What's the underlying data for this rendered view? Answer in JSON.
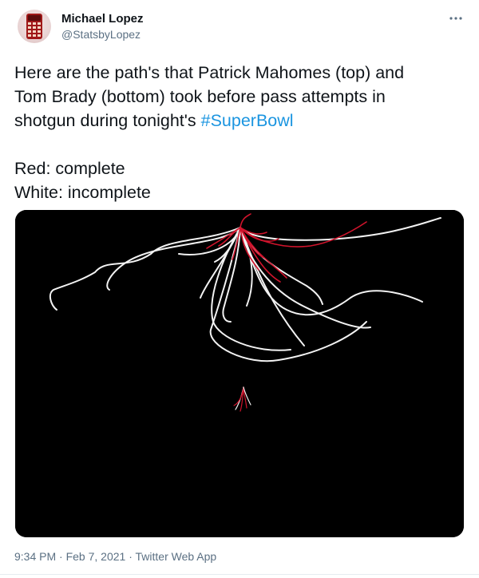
{
  "author": {
    "name": "Michael Lopez",
    "handle": "@StatsbyLopez"
  },
  "tweet": {
    "line1": "Here are the path's that Patrick Mahomes (top) and",
    "line2": "Tom Brady (bottom) took before pass attempts in",
    "line3_prefix": "shotgun during tonight's ",
    "hashtag": "#SuperBowl",
    "legend_red": "Red: complete",
    "legend_white": "White: incomplete"
  },
  "footer": {
    "time": "9:34 PM",
    "separator": " · ",
    "date": "Feb 7, 2021",
    "app": "Twitter Web App"
  },
  "colors": {
    "accent": "#1b95e0",
    "complete": "#d0142c",
    "incomplete": "#f2f2f2",
    "media_bg": "#000000"
  },
  "icons": {
    "more": "more-options-icon",
    "avatar": "calculator-avatar-icon"
  }
}
